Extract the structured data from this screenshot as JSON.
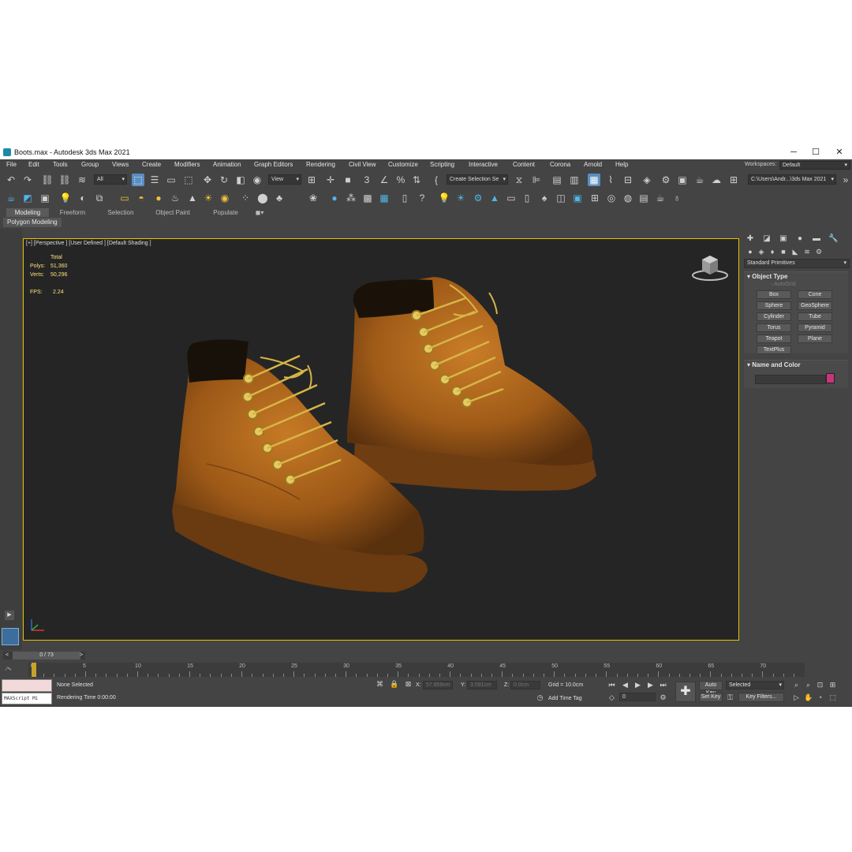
{
  "window": {
    "title": "Boots.max - Autodesk 3ds Max 2021",
    "minimize": "─",
    "maximize": "☐",
    "close": "✕"
  },
  "menu": [
    "File",
    "Edit",
    "Tools",
    "Group",
    "Views",
    "Create",
    "Modifiers",
    "Animation",
    "Graph Editors",
    "Rendering",
    "Civil View",
    "Customize",
    "Scripting",
    "Interactive",
    "Content",
    "Corona",
    "Arnold",
    "Help"
  ],
  "workspaces": {
    "label": "Workspaces:",
    "value": "Default"
  },
  "toolbar": {
    "filter_value": "All",
    "refcoord_value": "View",
    "selection_set_placeholder": "Create Selection Se",
    "project_path": "C:\\Users\\Andr...\\3ds Max 2021"
  },
  "ribbon": {
    "tabs": [
      "Modeling",
      "Freeform",
      "Selection",
      "Object Paint",
      "Populate"
    ],
    "active": "Modeling",
    "sub": "Polygon Modeling"
  },
  "viewport": {
    "label": "[+] [Perspective ] [User Defined ] [Default Shading ]",
    "stats": {
      "header": "Total",
      "polys_label": "Polys:",
      "polys": "51,360",
      "verts_label": "Verts:",
      "verts": "50,296",
      "fps_label": "FPS:",
      "fps": "2.24"
    }
  },
  "command_panel": {
    "category": "Standard Primitives",
    "object_type": {
      "title": "Object Type",
      "autogrid": "AutoGrid",
      "buttons": [
        "Box",
        "Cone",
        "Sphere",
        "GeoSphere",
        "Cylinder",
        "Tube",
        "Torus",
        "Pyramid",
        "Teapot",
        "Plane",
        "TextPlus"
      ]
    },
    "name_color": {
      "title": "Name and Color",
      "name_value": "",
      "color": "#c8357d"
    }
  },
  "timeline": {
    "frame_label": "0 / 73",
    "ticks": [
      "0",
      "5",
      "10",
      "15",
      "20",
      "25",
      "30",
      "35",
      "40",
      "45",
      "50",
      "55",
      "60",
      "65",
      "70"
    ]
  },
  "status": {
    "maxscript": "MAXScript Mi",
    "selection": "None Selected",
    "render_time": "Rendering Time  0:00:00",
    "x_label": "X:",
    "x": "57.859cm",
    "y_label": "Y:",
    "y": "3.591cm",
    "z_label": "Z:",
    "z": "0.0cm",
    "grid": "Grid = 10.0cm",
    "add_time_tag": "Add Time Tag",
    "auto_key": "Auto Key",
    "set_key": "Set Key",
    "selected": "Selected",
    "key_filters": "Key Filters...",
    "frame_field": "0"
  },
  "colors": {
    "accent": "#e6c200",
    "ui_bg": "#444444",
    "viewport_bg": "#252525",
    "active_btn": "#5a8ec2"
  }
}
